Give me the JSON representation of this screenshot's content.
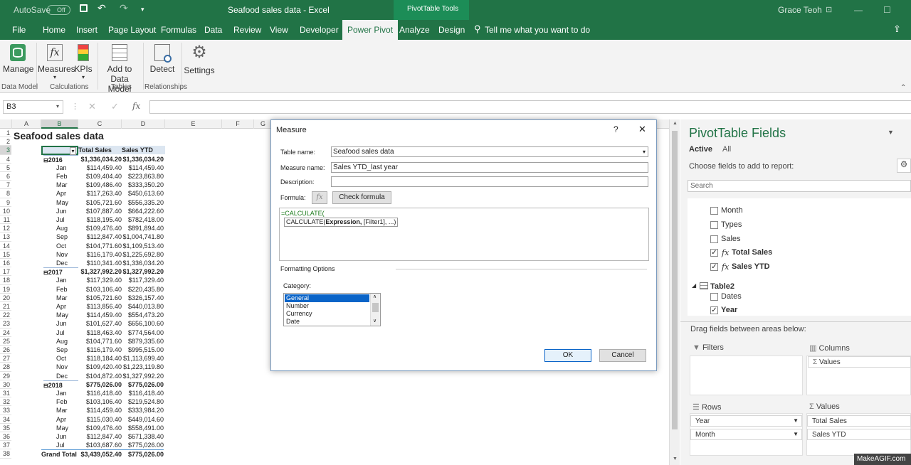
{
  "titlebar": {
    "autosave": "AutoSave",
    "autosave_state": "Off",
    "title": "Seafood sales data  -  Excel",
    "context": "PivotTable Tools",
    "user": "Grace Teoh"
  },
  "tabs": [
    "File",
    "Home",
    "Insert",
    "Page Layout",
    "Formulas",
    "Data",
    "Review",
    "View",
    "Developer",
    "Power Pivot",
    "Analyze",
    "Design"
  ],
  "tellme": "Tell me what you want to do",
  "ribbon": {
    "manage": "Manage",
    "measures": "Measures",
    "kpis": "KPIs",
    "add_to": "Add to",
    "data_model": "Data Model",
    "detect": "Detect",
    "settings": "Settings",
    "groups": {
      "data_model": "Data Model",
      "calculations": "Calculations",
      "tables": "Tables",
      "relationships": "Relationships"
    }
  },
  "formulabar": {
    "namebox": "B3",
    "fx": "fx"
  },
  "columns": [
    "A",
    "B",
    "C",
    "D",
    "E",
    "F",
    "G"
  ],
  "sheet": {
    "title": "Seafood sales data",
    "headers": [
      "",
      "Total Sales",
      "Sales YTD"
    ],
    "rows": [
      [
        "2016",
        "$1,336,034.20",
        "$1,336,034.20"
      ],
      [
        "Jan",
        "$114,459.40",
        "$114,459.40"
      ],
      [
        "Feb",
        "$109,404.40",
        "$223,863.80"
      ],
      [
        "Mar",
        "$109,486.40",
        "$333,350.20"
      ],
      [
        "Apr",
        "$117,263.40",
        "$450,613.60"
      ],
      [
        "May",
        "$105,721.60",
        "$556,335.20"
      ],
      [
        "Jun",
        "$107,887.40",
        "$664,222.60"
      ],
      [
        "Jul",
        "$118,195.40",
        "$782,418.00"
      ],
      [
        "Aug",
        "$109,476.40",
        "$891,894.40"
      ],
      [
        "Sep",
        "$112,847.40",
        "$1,004,741.80"
      ],
      [
        "Oct",
        "$104,771.60",
        "$1,109,513.40"
      ],
      [
        "Nov",
        "$116,179.40",
        "$1,225,692.80"
      ],
      [
        "Dec",
        "$110,341.40",
        "$1,336,034.20"
      ],
      [
        "2017",
        "$1,327,992.20",
        "$1,327,992.20"
      ],
      [
        "Jan",
        "$117,329.40",
        "$117,329.40"
      ],
      [
        "Feb",
        "$103,106.40",
        "$220,435.80"
      ],
      [
        "Mar",
        "$105,721.60",
        "$326,157.40"
      ],
      [
        "Apr",
        "$113,856.40",
        "$440,013.80"
      ],
      [
        "May",
        "$114,459.40",
        "$554,473.20"
      ],
      [
        "Jun",
        "$101,627.40",
        "$656,100.60"
      ],
      [
        "Jul",
        "$118,463.40",
        "$774,564.00"
      ],
      [
        "Aug",
        "$104,771.60",
        "$879,335.60"
      ],
      [
        "Sep",
        "$116,179.40",
        "$995,515.00"
      ],
      [
        "Oct",
        "$118,184.40",
        "$1,113,699.40"
      ],
      [
        "Nov",
        "$109,420.40",
        "$1,223,119.80"
      ],
      [
        "Dec",
        "$104,872.40",
        "$1,327,992.20"
      ],
      [
        "2018",
        "$775,026.00",
        "$775,026.00"
      ],
      [
        "Jan",
        "$116,418.40",
        "$116,418.40"
      ],
      [
        "Feb",
        "$103,106.40",
        "$219,524.80"
      ],
      [
        "Mar",
        "$114,459.40",
        "$333,984.20"
      ],
      [
        "Apr",
        "$115,030.40",
        "$449,014.60"
      ],
      [
        "May",
        "$109,476.40",
        "$558,491.00"
      ],
      [
        "Jun",
        "$112,847.40",
        "$671,338.40"
      ],
      [
        "Jul",
        "$103,687.60",
        "$775,026.00"
      ]
    ],
    "grand": [
      "Grand Total",
      "$3,439,052.40",
      "$775,026.00"
    ]
  },
  "dialog": {
    "title": "Measure",
    "help": "?",
    "close": "✕",
    "table_name_label": "Table name:",
    "table_name": "Seafood sales data",
    "measure_name_label": "Measure name:",
    "measure_name": "Sales YTD_last year",
    "description_label": "Description:",
    "description": "",
    "formula_label": "Formula:",
    "fx": "fx",
    "check": "Check formula",
    "formula": "=CALCULATE(",
    "tip_fn": "CALCULATE(",
    "tip_bold": "Expression,",
    "tip_rest": " [Filter1], ...)",
    "formatting": "Formatting Options",
    "category_label": "Category:",
    "categories": [
      "General",
      "Number",
      "Currency",
      "Date"
    ],
    "ok": "OK",
    "cancel": "Cancel"
  },
  "pane": {
    "title": "PivotTable Fields",
    "active": "Active",
    "all": "All",
    "choose": "Choose fields to add to report:",
    "search": "Search",
    "fields": [
      {
        "name": "Month",
        "checked": false,
        "fx": false
      },
      {
        "name": "Types",
        "checked": false,
        "fx": false
      },
      {
        "name": "Sales",
        "checked": false,
        "fx": false
      },
      {
        "name": "Total Sales",
        "checked": true,
        "fx": true
      },
      {
        "name": "Sales YTD",
        "checked": true,
        "fx": true
      }
    ],
    "table2": "Table2",
    "fields2": [
      {
        "name": "Dates",
        "checked": false
      },
      {
        "name": "Year",
        "checked": true
      }
    ],
    "drag": "Drag fields between areas below:",
    "filters": "Filters",
    "columns": "Columns",
    "rows": "Rows",
    "values": "Values",
    "col_values": "Values",
    "row_items": [
      "Year",
      "Month"
    ],
    "value_items": [
      "Total Sales",
      "Sales YTD"
    ]
  },
  "watermark": "MakeAGIF.com"
}
